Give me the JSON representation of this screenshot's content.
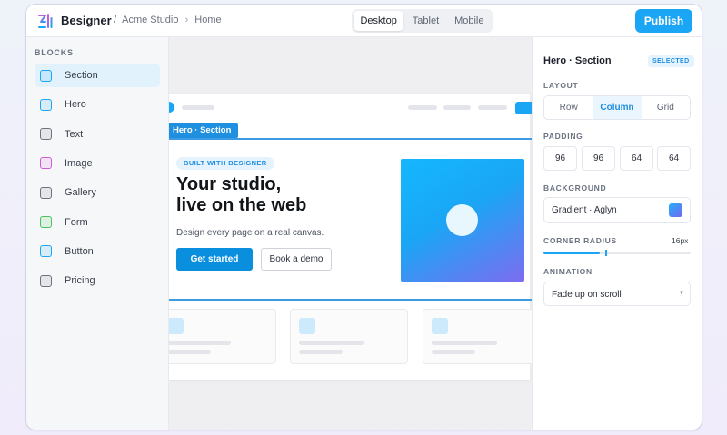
{
  "app": {
    "name": "Besigner",
    "breadcrumb": [
      "Acme Studio",
      "Home"
    ],
    "breadcrumb_sep": "›",
    "breadcrumb_prefix": "/"
  },
  "devices": [
    {
      "label": "Desktop",
      "active": true
    },
    {
      "label": "Tablet",
      "active": false
    },
    {
      "label": "Mobile",
      "active": false
    }
  ],
  "toolbar": {
    "publish_label": "Publish"
  },
  "sidebar": {
    "title": "BLOCKS",
    "items": [
      {
        "label": "Section",
        "color": "#1aa6f5",
        "active": true
      },
      {
        "label": "Hero",
        "color": "#1aa6f5",
        "active": false
      },
      {
        "label": "Text",
        "color": "#6b7280",
        "active": false
      },
      {
        "label": "Image",
        "color": "#d05ad8",
        "active": false
      },
      {
        "label": "Gallery",
        "color": "#6b7280",
        "active": false
      },
      {
        "label": "Form",
        "color": "#4cc05a",
        "active": false
      },
      {
        "label": "Button",
        "color": "#1aa6f5",
        "active": false
      },
      {
        "label": "Pricing",
        "color": "#6b7280",
        "active": false
      }
    ]
  },
  "canvas": {
    "selection_tag": "Hero · Section",
    "hero": {
      "badge": "BUILT WITH BESIGNER",
      "title_line1": "Your studio,",
      "title_line2": "live on the web",
      "subtitle": "Design every page on a real canvas.",
      "primary_cta": "Get started",
      "secondary_cta": "Book a demo"
    }
  },
  "panel": {
    "title": "Hero · Section",
    "badge": "SELECTED",
    "layout": {
      "label": "LAYOUT",
      "options": [
        "Row",
        "Column",
        "Grid"
      ],
      "selected": "Column"
    },
    "padding": {
      "label": "PADDING",
      "values": [
        "96",
        "96",
        "64",
        "64"
      ]
    },
    "background": {
      "label": "BACKGROUND",
      "value": "Gradient · Aglyn"
    },
    "corner_radius": {
      "label": "CORNER RADIUS",
      "value": "16px",
      "fill_fraction": 0.38
    },
    "animation": {
      "label": "ANIMATION",
      "value": "Fade up on scroll"
    }
  },
  "colors": {
    "accent": "#1aa6f5",
    "selection": "#1f8fe0"
  }
}
